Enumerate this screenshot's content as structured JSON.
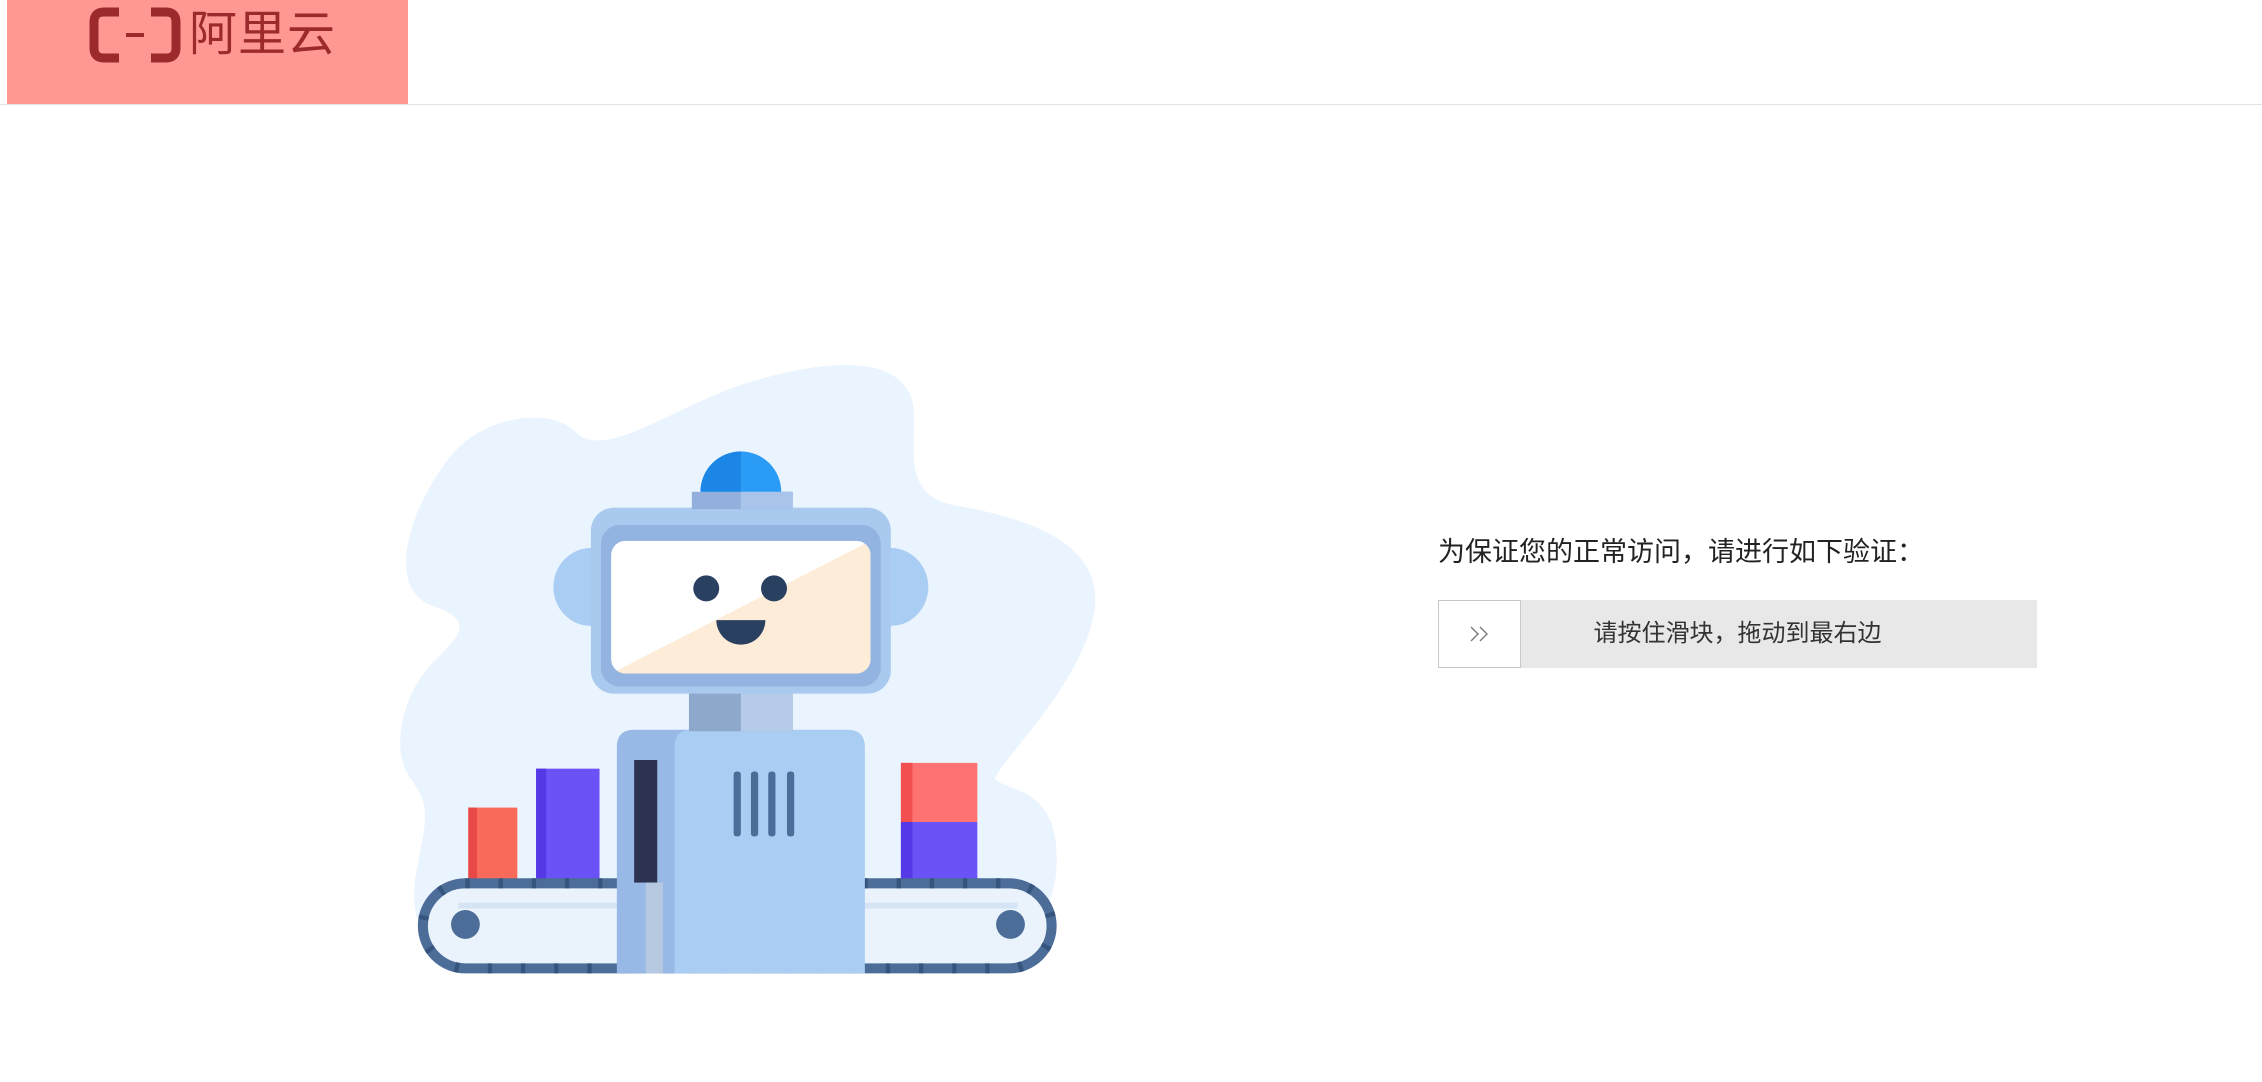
{
  "header": {
    "logo_text": "阿里云",
    "logo_icon": "aliyun-bracket-logo-icon"
  },
  "illustration": {
    "icon": "robot-conveyor-illustration"
  },
  "verification": {
    "prompt": "为保证您的正常访问，请进行如下验证：",
    "slider": {
      "hint": "请按住滑块，拖动到最右边",
      "knob_icon": "double-chevron-right-icon",
      "progress": 0
    }
  },
  "colors": {
    "logo_background": "#FF9893",
    "logo_foreground": "#9C2A2C",
    "slider_track": "#E8E8E8",
    "slider_knob": "#FFFFFF",
    "text": "#222222"
  }
}
